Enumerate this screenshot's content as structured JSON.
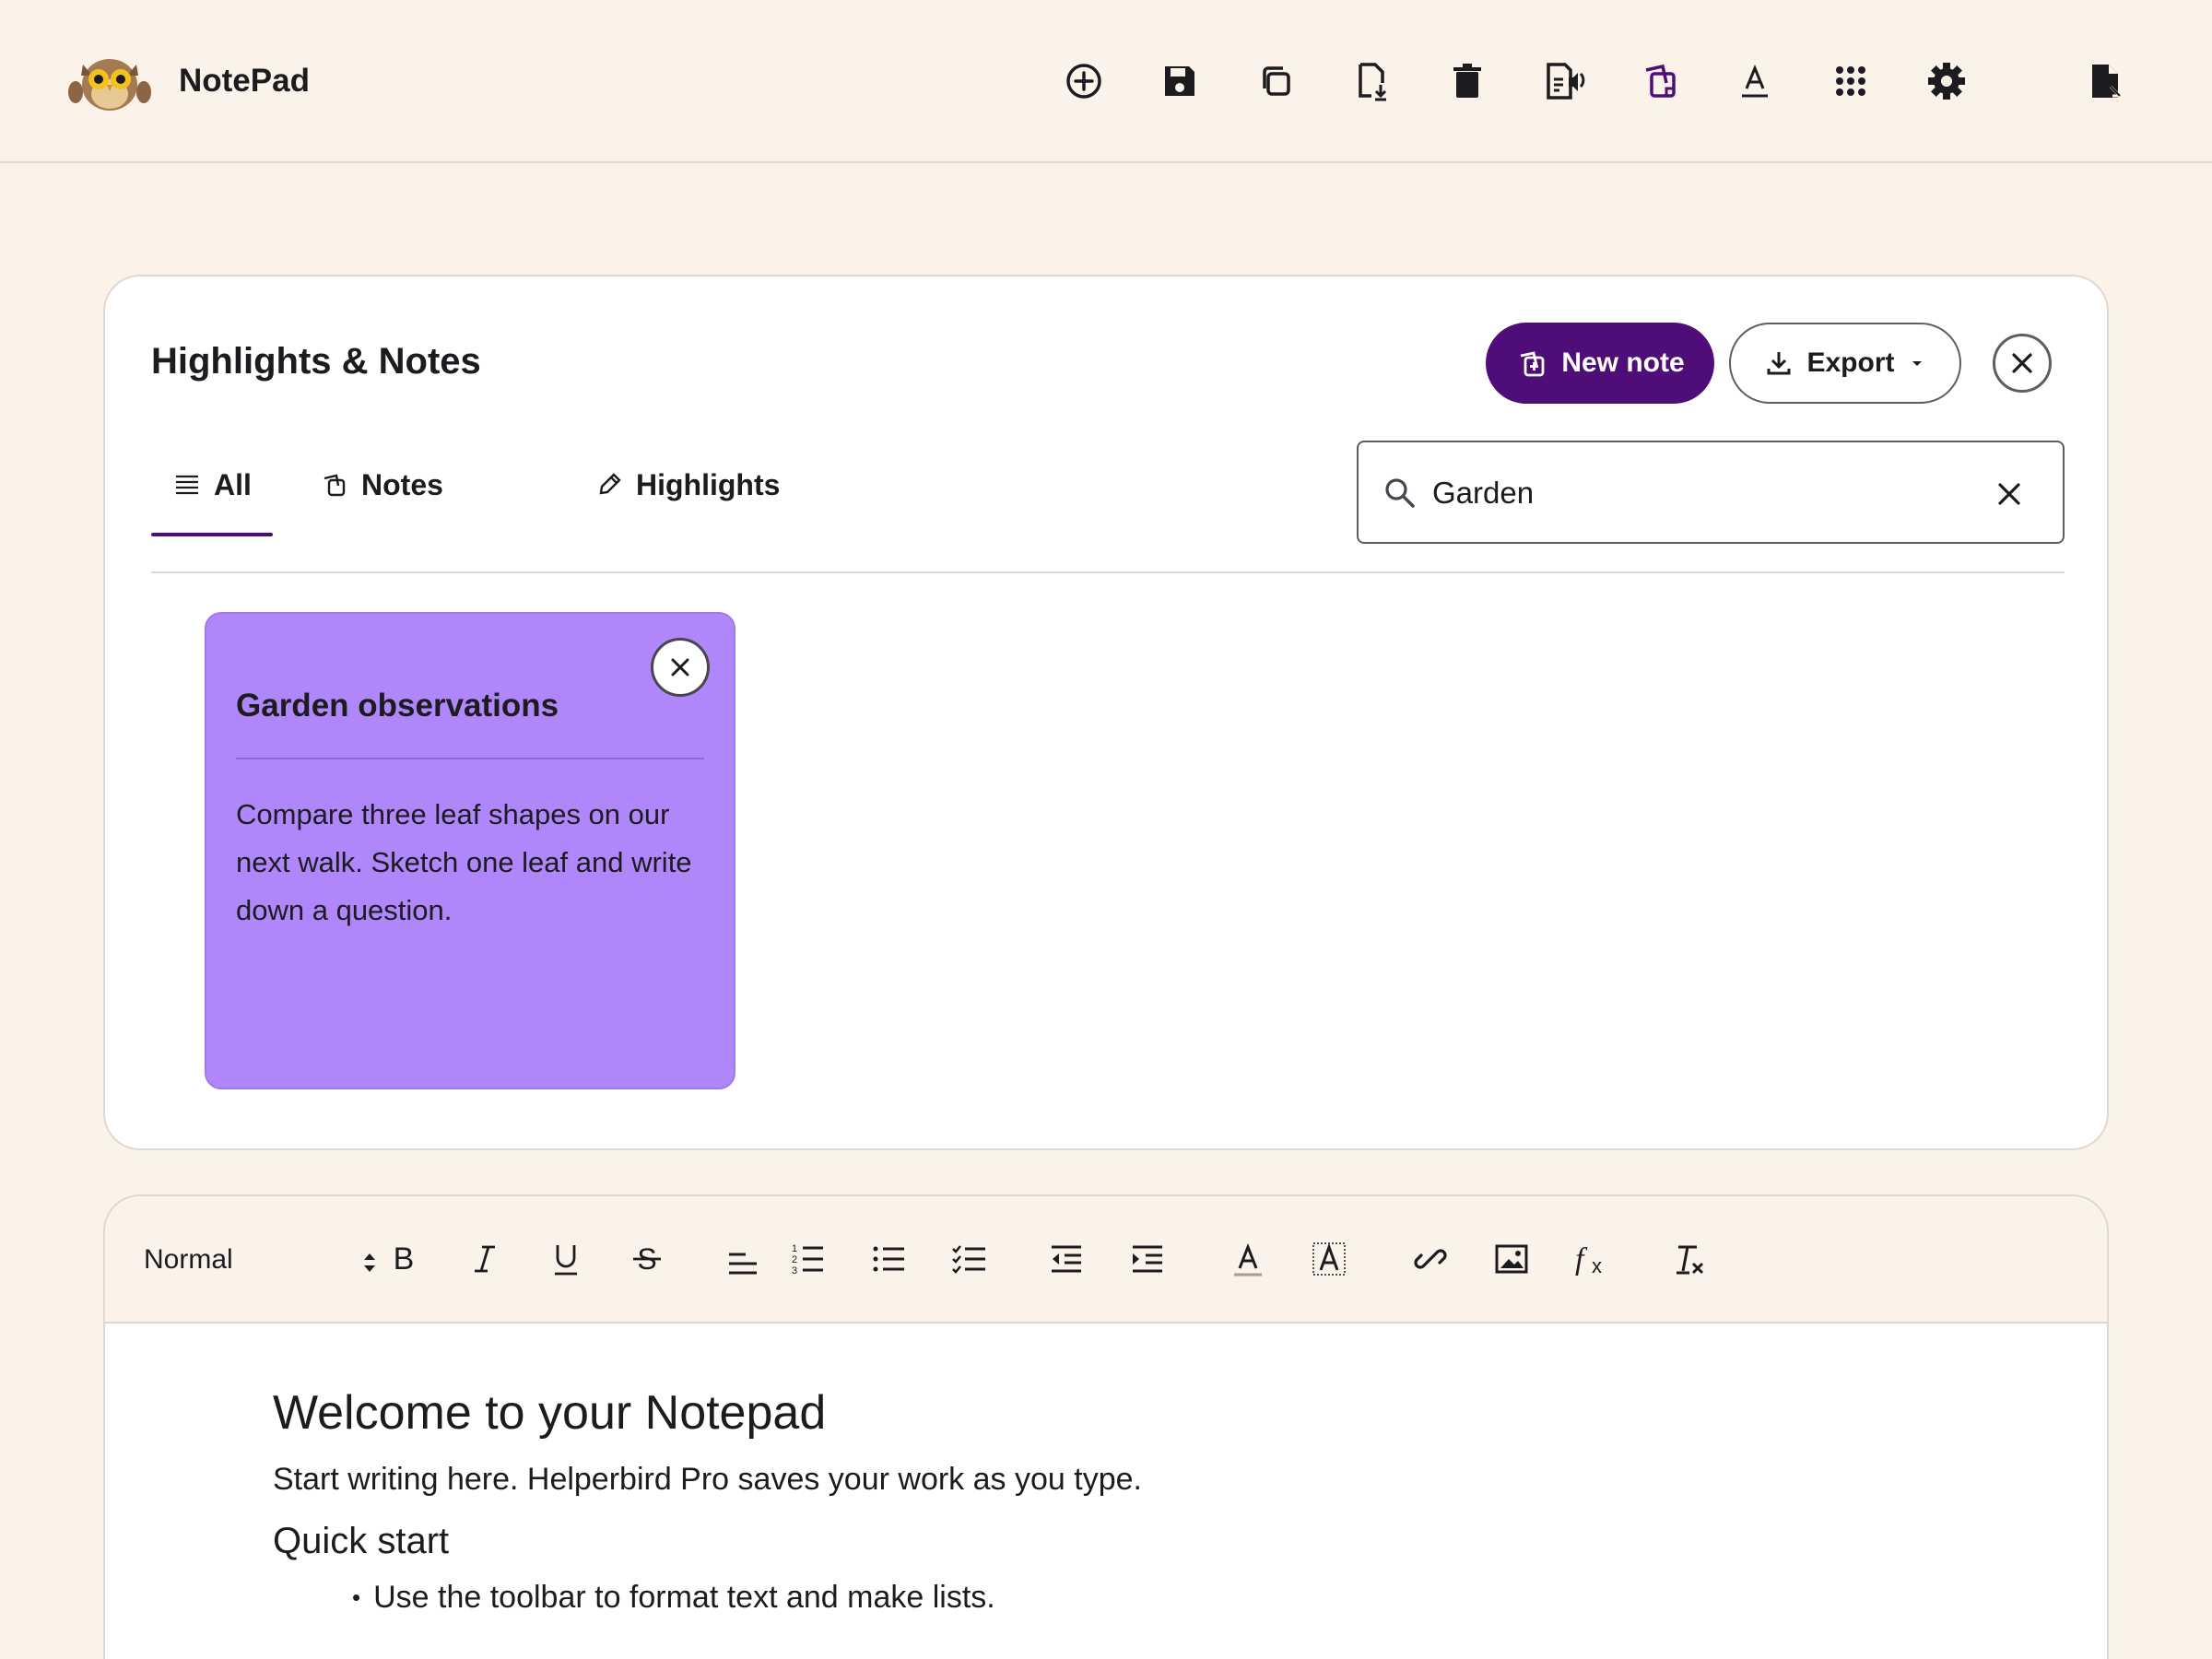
{
  "app": {
    "name": "NotePad"
  },
  "toolbar_icons": [
    "add-circle-icon",
    "save-icon",
    "copy-icon",
    "file-download-icon",
    "delete-icon",
    "read-aloud-icon",
    "notes-icon",
    "text-format-icon",
    "apps-grid-icon",
    "settings-icon",
    "document-export-icon"
  ],
  "panel": {
    "title": "Highlights & Notes",
    "new_note_label": "New note",
    "export_label": "Export",
    "tabs": [
      {
        "label": "All",
        "active": true
      },
      {
        "label": "Notes",
        "active": false
      },
      {
        "label": "Highlights",
        "active": false
      }
    ],
    "search": {
      "value": "Garden",
      "placeholder": ""
    },
    "notes": [
      {
        "title": "Garden observations",
        "body": "Compare three leaf shapes on our next walk. Sketch one leaf and write down a question.",
        "color": "#af87fb"
      }
    ]
  },
  "editor": {
    "format": "Normal",
    "document": {
      "heading": "Welcome to your Notepad",
      "intro": "Start writing here. Helperbird Pro saves your work as you type.",
      "subheading": "Quick start",
      "bullets": [
        "Use the toolbar to format text and make lists."
      ]
    }
  },
  "colors": {
    "background": "#fbf2ea",
    "accent": "#4f0d78",
    "note_purple": "#af87fb",
    "text": "#1c1b1f"
  }
}
